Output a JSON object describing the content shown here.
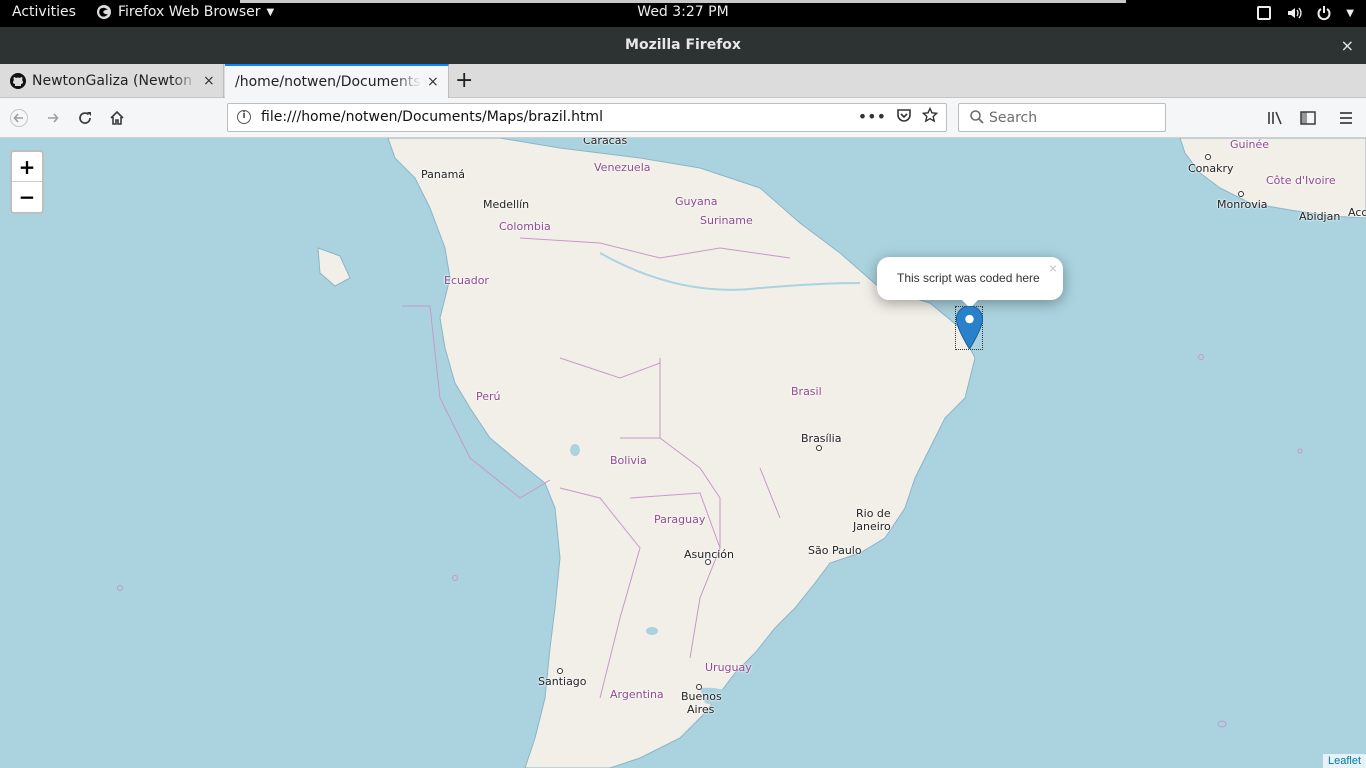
{
  "system_bar": {
    "activities": "Activities",
    "app_menu": "Firefox Web Browser",
    "clock": "Wed  3:27 PM"
  },
  "window": {
    "title": "Mozilla Firefox",
    "close": "×"
  },
  "tabs": [
    {
      "label": "NewtonGaliza (Newton Galiza)",
      "close": "×",
      "icon": "github-icon",
      "active": false
    },
    {
      "label": "/home/notwen/Documents/Maps/brazil.html",
      "close": "×",
      "active": true
    }
  ],
  "new_tab": "+",
  "navigation": {
    "url": "file:///home/notwen/Documents/Maps/brazil.html",
    "page_actions": [
      "•••",
      "pocket-icon",
      "bookmark-star-icon"
    ],
    "search_placeholder": "Search"
  },
  "map": {
    "zoom_in": "+",
    "zoom_out": "−",
    "popup_text": "This script was coded here",
    "popup_close": "×",
    "attribution": "Leaflet",
    "labels": {
      "panama": "Panamá",
      "caracas": "Caracas",
      "venezuela": "Venezuela",
      "medellin": "Medellín",
      "colombia": "Colombia",
      "guyana": "Guyana",
      "suriname": "Suriname",
      "ecuador": "Ecuador",
      "peru": "Perú",
      "brasil": "Brasil",
      "brasilia": "Brasília",
      "bolivia": "Bolivia",
      "paraguay": "Paraguay",
      "asuncion": "Asunción",
      "rio_line1": "Rio de",
      "rio_line2": "Janeiro",
      "sao_paulo": "São Paulo",
      "uruguay": "Uruguay",
      "santiago": "Santiago",
      "argentina": "Argentina",
      "buenos_line1": "Buenos",
      "buenos_line2": "Aires",
      "guinee": "Guinée",
      "conakry": "Conakry",
      "cote_divoire": "Côte d'Ivoire",
      "monrovia": "Monrovia",
      "abidjan": "Abidjan",
      "accra": "Acc"
    }
  },
  "colors": {
    "ocean": "#aad3df",
    "land": "#f2efe9",
    "border": "#c69ac6",
    "marker": "#2a81cb",
    "active_tab_accent": "#0a84ff"
  }
}
